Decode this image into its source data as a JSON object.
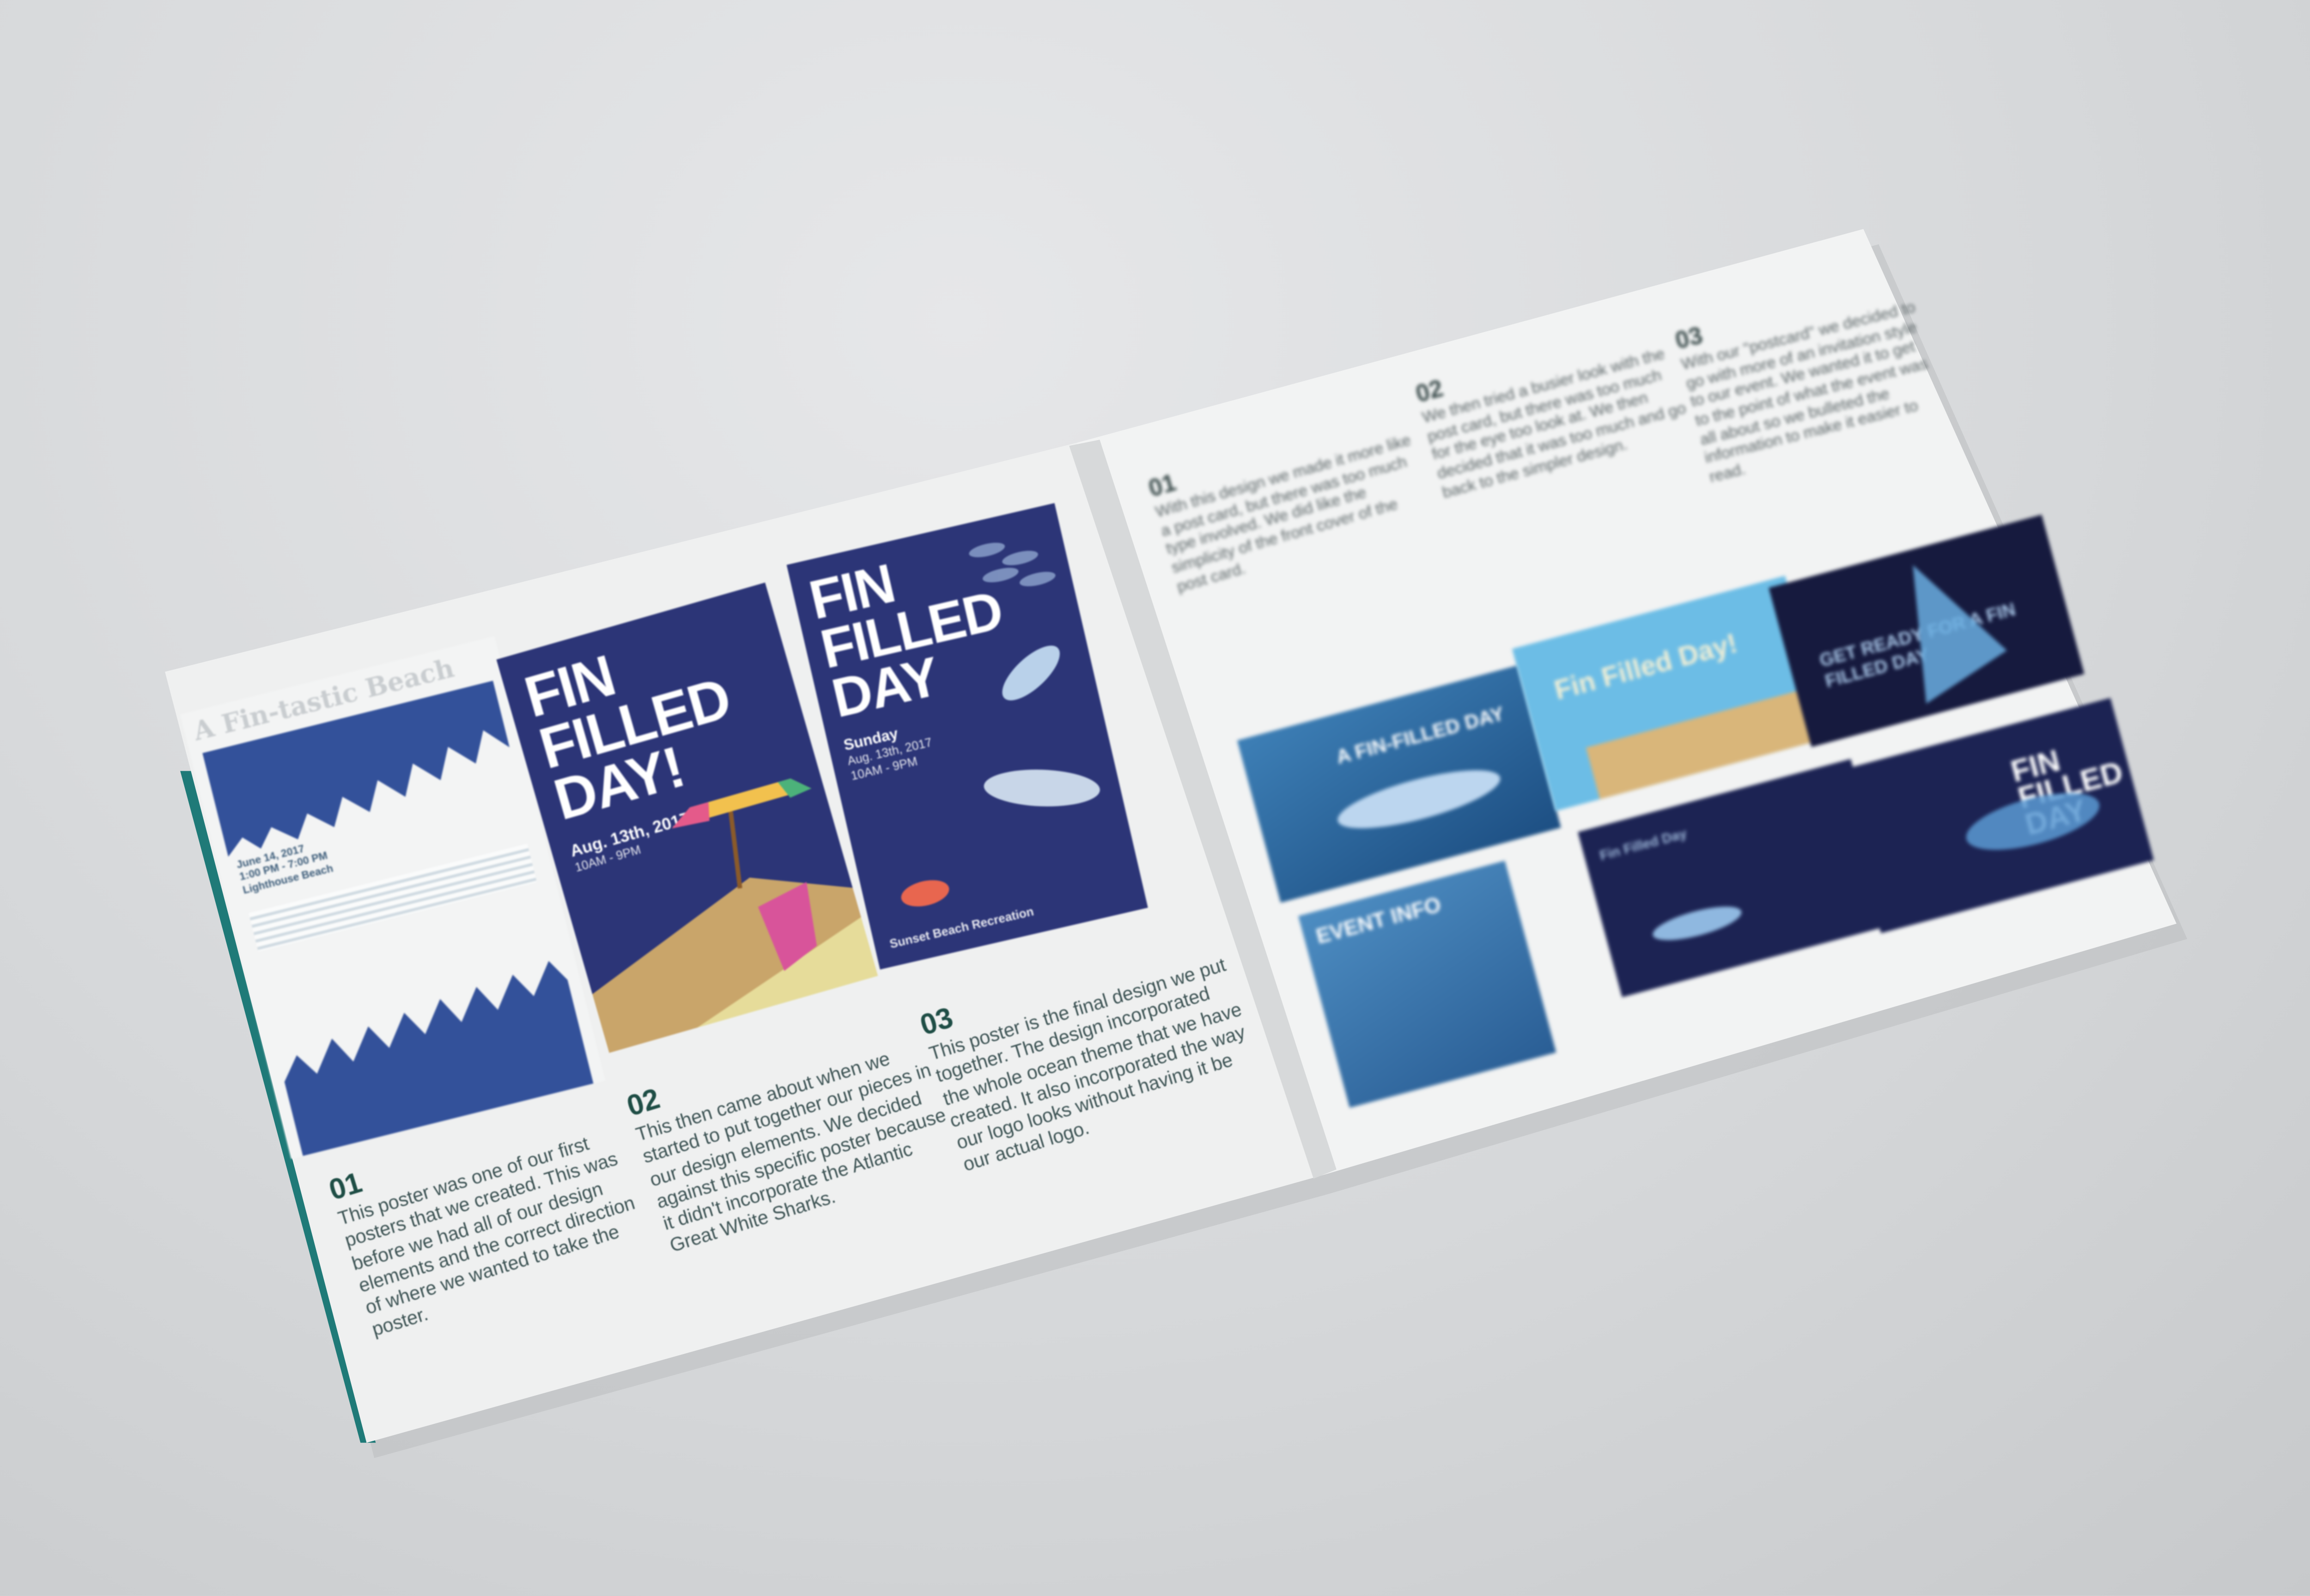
{
  "left_page": {
    "flyer": {
      "title": "A Fin-tastic Beach",
      "date": "June 14, 2017",
      "time": "1:00 PM - 7:00 PM",
      "place": "Lighthouse Beach"
    },
    "poster_1": {
      "headline": "FIN FILLED DAY!",
      "date": "Aug. 13th, 2017",
      "time": "10AM - 9PM"
    },
    "poster_2": {
      "headline": "FIN FILLED DAY",
      "day": "Sunday",
      "date": "Aug. 13th, 2017",
      "time": "10AM - 9PM",
      "venue": "Sunset Beach Recreation"
    },
    "notes": [
      {
        "num": "01",
        "text": "This poster was one of our first posters that we created. This was before we had all of our design elements and the correct direction of where we wanted to take the poster."
      },
      {
        "num": "02",
        "text": "This then came about when we started to put together our pieces in our design elements. We decided against this specific poster because it didn't incorporate the Atlantic Great White Sharks."
      },
      {
        "num": "03",
        "text": "This poster is the final design we put together. The design incorporated the whole ocean theme that we have created. It also incorporated the way our logo looks without having it be our actual logo."
      }
    ]
  },
  "right_page": {
    "notes": [
      {
        "num": "01",
        "text": "With this design we made it more like a post card, but there was too much type involved. We did like the simplicity of the front cover of the post card."
      },
      {
        "num": "02",
        "text": "We then tried a busier look with the post card, but there was too much for the eye too look at. We then decided that it was too much and go back to the simpler design."
      },
      {
        "num": "03",
        "text": "With our \"postcard\" we decided to go with more of an invitation style to our event. We wanted it to get to the point of what the event was all about so we bulleted the information to make it easier to read."
      }
    ],
    "thumbnails": [
      {
        "label": "A FIN-FILLED DAY"
      },
      {
        "label": "Fin Filled Day!"
      },
      {
        "label": "GET READY FOR A FIN FILLED DAY"
      },
      {
        "label": "EVENT INFO"
      },
      {
        "label": "Fin Filled Day"
      },
      {
        "label": "FIN FILLED DAY"
      }
    ]
  },
  "colors": {
    "navy": "#2c3577",
    "deep_navy": "#161a3e",
    "sky": "#5eb3e0",
    "teal_edge": "#1f7a78",
    "paper": "#f1f2f2"
  }
}
